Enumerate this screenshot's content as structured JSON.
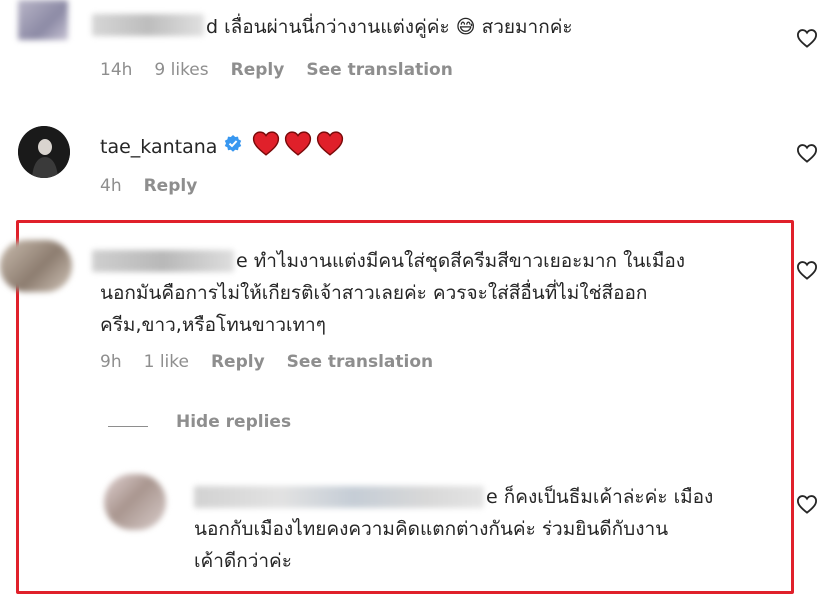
{
  "comment1": {
    "username_suffix": "d",
    "text": "เลื่อนผ่านนี่กว่างานแต่งคู่ค่ะ",
    "emoji": "😅",
    "text2": "สวยมากค่ะ",
    "meta": {
      "time": "14h",
      "likes": "9 likes",
      "reply": "Reply",
      "translate": "See translation"
    }
  },
  "comment2": {
    "username": "tae_kantana",
    "meta": {
      "time": "4h",
      "reply": "Reply"
    }
  },
  "comment3": {
    "username_suffix": "e",
    "lines": [
      "ทำไมงานแต่งมีคนใส่ชุดสีครีมสีขาวเยอะมาก ในเมือง",
      "นอกมันคือการไม่ให้เกียรติเจ้าสาวเลยค่ะ ควรจะใส่สีอื่นที่ไม่ใช่สีออก",
      "ครีม,ขาว,หรือโทนขาวเทาๆ"
    ],
    "meta": {
      "time": "9h",
      "likes": "1 like",
      "reply": "Reply",
      "translate": "See translation"
    },
    "hide_replies": "Hide replies"
  },
  "reply1": {
    "username_suffix": "e",
    "lines": [
      "ก็คงเป็นธีมเค้าล่ะค่ะ เมือง",
      "นอกกับเมืองไทยคงความคิดแตกต่างกันค่ะ ร่วมยินดีกับงาน",
      "เค้าดีกว่าค่ะ"
    ]
  },
  "colors": {
    "highlight": "#e0202a",
    "verified": "#3897f0",
    "heart_red": "#e0202a",
    "meta": "#8e8e8e"
  }
}
